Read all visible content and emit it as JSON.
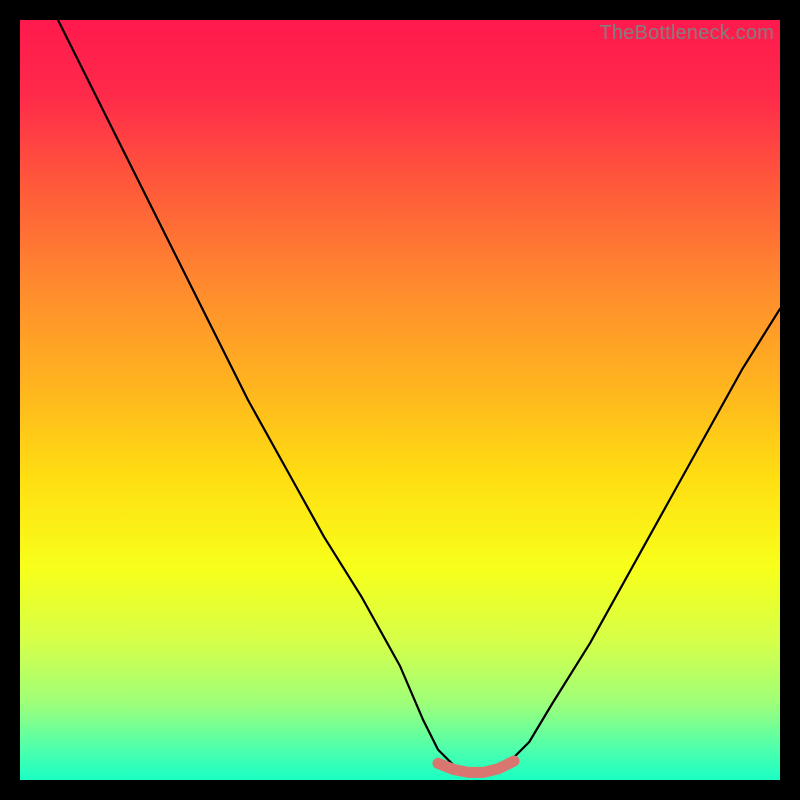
{
  "attribution": "TheBottleneck.com",
  "colors": {
    "frame": "#000000",
    "gradient_stops": [
      {
        "offset": 0.0,
        "color": "#ff1a4d"
      },
      {
        "offset": 0.1,
        "color": "#ff2a4a"
      },
      {
        "offset": 0.22,
        "color": "#ff5a3a"
      },
      {
        "offset": 0.35,
        "color": "#ff8a2e"
      },
      {
        "offset": 0.48,
        "color": "#ffb41f"
      },
      {
        "offset": 0.6,
        "color": "#ffdd12"
      },
      {
        "offset": 0.72,
        "color": "#f8ff1a"
      },
      {
        "offset": 0.82,
        "color": "#d4ff4a"
      },
      {
        "offset": 0.9,
        "color": "#9dff7a"
      },
      {
        "offset": 0.96,
        "color": "#4dffad"
      },
      {
        "offset": 1.0,
        "color": "#1affc4"
      }
    ],
    "curve": "#000000",
    "marker": "#d8766f"
  },
  "chart_data": {
    "type": "line",
    "title": "",
    "xlabel": "",
    "ylabel": "",
    "xlim": [
      0,
      100
    ],
    "ylim": [
      0,
      100
    ],
    "series": [
      {
        "name": "bottleneck-curve",
        "x": [
          5,
          10,
          15,
          20,
          25,
          30,
          35,
          40,
          45,
          50,
          53,
          55,
          57,
          60,
          62,
          64,
          67,
          70,
          75,
          80,
          85,
          90,
          95,
          100
        ],
        "y": [
          100,
          90,
          80,
          70,
          60,
          50,
          41,
          32,
          24,
          15,
          8,
          4,
          2,
          1,
          1,
          2,
          5,
          10,
          18,
          27,
          36,
          45,
          54,
          62
        ]
      },
      {
        "name": "bottom-markers",
        "x": [
          55,
          57,
          59,
          61,
          63,
          65
        ],
        "y": [
          2.2,
          1.4,
          1.0,
          1.0,
          1.5,
          2.5
        ]
      }
    ]
  }
}
